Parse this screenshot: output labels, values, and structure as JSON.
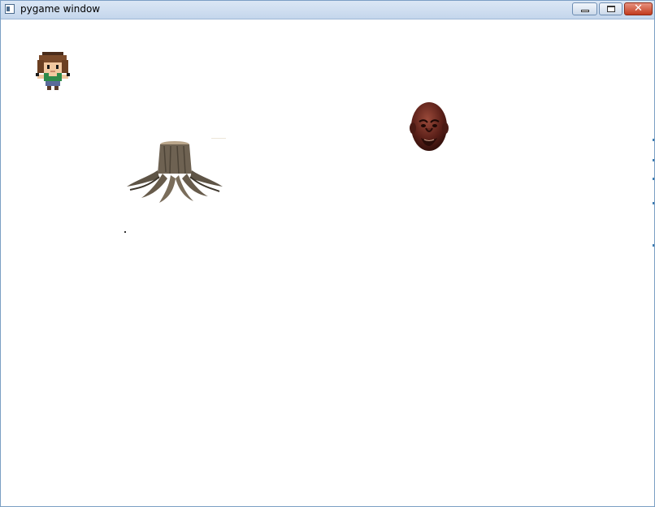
{
  "window": {
    "title": "pygame window",
    "controls": {
      "minimize": "minimize-icon",
      "maximize": "maximize-icon",
      "close": "close-icon"
    }
  },
  "game": {
    "entities": [
      {
        "name": "player-character",
        "icon": "pixel-girl-sprite"
      },
      {
        "name": "tree-stump",
        "icon": "tree-stump-image"
      },
      {
        "name": "enemy-head",
        "icon": "crying-face-head-image"
      }
    ],
    "colors": {
      "background": "#ffffff",
      "titlebar": "#c4d6ec",
      "close_button": "#c23b1e"
    }
  }
}
